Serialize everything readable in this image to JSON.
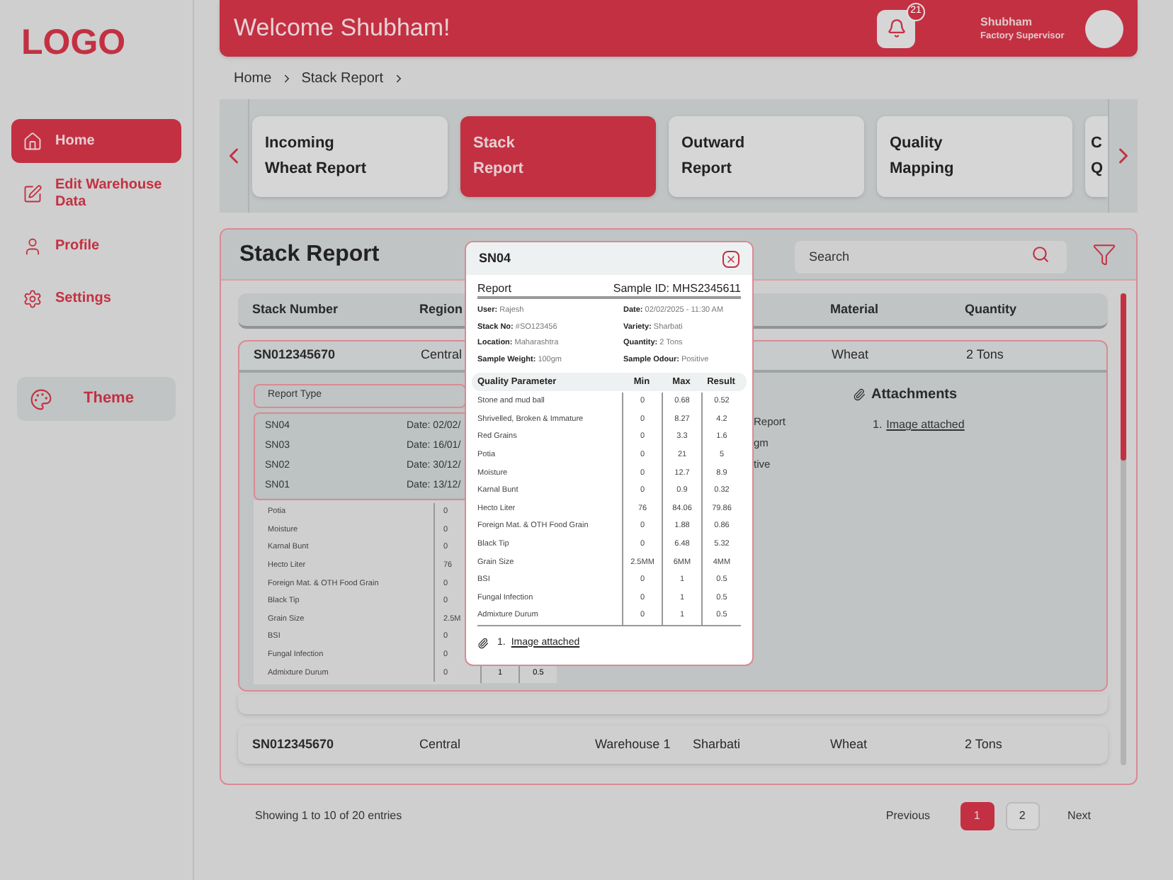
{
  "sidebar": {
    "logo": "LOGO",
    "items": [
      {
        "label": "Home",
        "selected": true
      },
      {
        "label": "Edit Warehouse Data",
        "selected": false
      },
      {
        "label": "Profile",
        "selected": false
      },
      {
        "label": "Settings",
        "selected": false
      }
    ],
    "theme_button": "Theme"
  },
  "header": {
    "welcome": "Welcome Shubham!",
    "notification_count": "21",
    "user_name": "Shubham",
    "user_role": "Factory Supervisor"
  },
  "breadcrumb": [
    "Home",
    "Stack Report"
  ],
  "report_tabs": [
    {
      "lines": [
        "Incoming",
        "Wheat Report"
      ],
      "selected": false
    },
    {
      "lines": [
        "Stack",
        "Report"
      ],
      "selected": true
    },
    {
      "lines": [
        "Outward",
        "Report"
      ],
      "selected": false
    },
    {
      "lines": [
        "Quality",
        "Mapping"
      ],
      "selected": false
    },
    {
      "lines": [
        "C",
        "Q"
      ],
      "selected": false
    }
  ],
  "panel": {
    "title": "Stack Report",
    "search_placeholder": "Search"
  },
  "table": {
    "columns": [
      "Stack Number",
      "Region",
      null,
      null,
      "Material",
      "Quantity"
    ],
    "rows": [
      {
        "cells": [
          "SN012345670",
          "Central",
          null,
          null,
          "Wheat",
          "2 Tons"
        ],
        "expanded": true
      },
      {
        "cells": [
          "SN012345670",
          "Central",
          "Warehouse 1",
          "Sharbati",
          "Wheat",
          "2 Tons"
        ],
        "expanded": false
      }
    ]
  },
  "expanded_detail": {
    "report_type_label": "Report Type",
    "reports": [
      {
        "id": "SN04",
        "date": "Date: 02/02/"
      },
      {
        "id": "SN03",
        "date": "Date: 16/01/"
      },
      {
        "id": "SN02",
        "date": "Date: 30/12/"
      },
      {
        "id": "SN01",
        "date": "Date: 13/12/"
      }
    ],
    "parameters": [
      {
        "name": "Potia",
        "min": "0"
      },
      {
        "name": "Moisture",
        "min": "0"
      },
      {
        "name": "Karnal Bunt",
        "min": "0"
      },
      {
        "name": "Hecto Liter",
        "min": "76"
      },
      {
        "name": "Foreign Mat. & OTH Food Grain",
        "min": "0"
      },
      {
        "name": "Black Tip",
        "min": "0"
      },
      {
        "name": "Grain Size",
        "min": "2.5M"
      },
      {
        "name": "BSI",
        "min": "0"
      },
      {
        "name": "Fungal Infection",
        "min": "0"
      },
      {
        "name": "Admixture Durum",
        "min": "0"
      }
    ],
    "last_row_cells": [
      "1",
      "0.5"
    ],
    "info_fragments": [
      "Report",
      "gm",
      "tive"
    ],
    "attachments_title": "Attachments",
    "attachments": [
      {
        "number": "1.",
        "label": "Image attached"
      }
    ]
  },
  "modal": {
    "title": "SN04",
    "section": "Report",
    "sample_id": "Sample ID: MHS2345611",
    "info": [
      {
        "label": "User:",
        "value": "Rajesh"
      },
      {
        "label": "Date:",
        "value": "02/02/2025 - 11:30 AM"
      },
      {
        "label": "Stack No:",
        "value": "#SO123456"
      },
      {
        "label": "Variety:",
        "value": "Sharbati"
      },
      {
        "label": "Location:",
        "value": "Maharashtra"
      },
      {
        "label": "Quantity:",
        "value": "2 Tons"
      },
      {
        "label": "Sample Weight:",
        "value": "100gm"
      },
      {
        "label": "Sample Odour:",
        "value": "Positive"
      }
    ],
    "columns": [
      "Quality Parameter",
      "Min",
      "Max",
      "Result"
    ],
    "rows": [
      [
        "Stone and mud ball",
        "0",
        "0.68",
        "0.52"
      ],
      [
        "Shrivelled, Broken & Immature",
        "0",
        "8.27",
        "4.2"
      ],
      [
        "Red Grains",
        "0",
        "3.3",
        "1.6"
      ],
      [
        "Potia",
        "0",
        "21",
        "5"
      ],
      [
        "Moisture",
        "0",
        "12.7",
        "8.9"
      ],
      [
        "Karnal Bunt",
        "0",
        "0.9",
        "0.32"
      ],
      [
        "Hecto Liter",
        "76",
        "84.06",
        "79.86"
      ],
      [
        "Foreign Mat. & OTH Food Grain",
        "0",
        "1.88",
        "0.86"
      ],
      [
        "Black Tip",
        "0",
        "6.48",
        "5.32"
      ],
      [
        "Grain Size",
        "2.5MM",
        "6MM",
        "4MM"
      ],
      [
        "BSI",
        "0",
        "1",
        "0.5"
      ],
      [
        "Fungal Infection",
        "0",
        "1",
        "0.5"
      ],
      [
        "Admixture Durum",
        "0",
        "1",
        "0.5"
      ]
    ],
    "attachments": [
      {
        "number": "1.",
        "label": "Image attached"
      }
    ]
  },
  "footer": {
    "entries": "Showing 1 to 10 of 20 entries",
    "previous": "Previous",
    "pages": [
      {
        "label": "1",
        "selected": true
      },
      {
        "label": "2",
        "selected": false
      }
    ],
    "next": "Next"
  }
}
